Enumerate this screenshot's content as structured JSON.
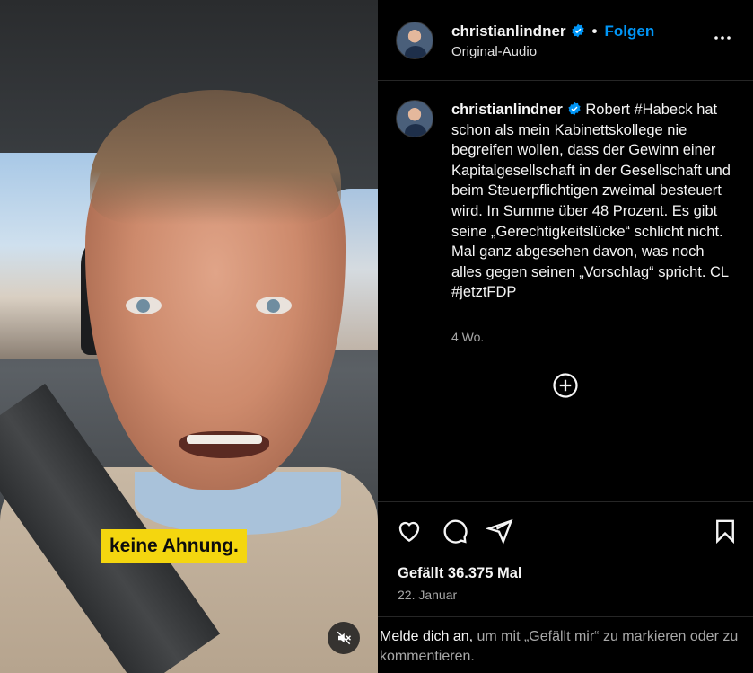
{
  "video": {
    "caption": "keine Ahnung.",
    "mute_icon": "muted-speaker-icon"
  },
  "header": {
    "username": "christianlindner",
    "verified_icon": "verified-badge-icon",
    "separator": "•",
    "follow_label": "Folgen",
    "audio_label": "Original-Audio",
    "more_icon": "more-options-icon"
  },
  "post": {
    "username": "christianlindner",
    "text": "Robert #Habeck hat schon als mein Kabinettskollege nie begreifen wollen, dass der Gewinn einer Kapitalgesellschaft in der Gesellschaft und beim Steuerpflichtigen zweimal besteuert wird. In Summe über 48 Prozent. Es gibt seine „Gerechtigkeitslücke“ schlicht nicht. Mal ganz abgesehen davon, was noch alles gegen seinen „Vorschlag“ spricht. CL #jetztFDP",
    "time": "4 Wo.",
    "load_more_icon": "plus-circle-icon"
  },
  "actions": {
    "icons": [
      "heart-icon",
      "comment-icon",
      "share-icon",
      "bookmark-icon"
    ],
    "likes": "Gefällt 36.375 Mal",
    "date": "22. Januar"
  },
  "login_prompt": {
    "link": "Melde dich an,",
    "rest": " um mit „Gefällt mir“ zu markieren oder zu kommentieren."
  },
  "colors": {
    "accent": "#0095f6",
    "caption_bg": "#f4d60f",
    "background": "#000000"
  }
}
